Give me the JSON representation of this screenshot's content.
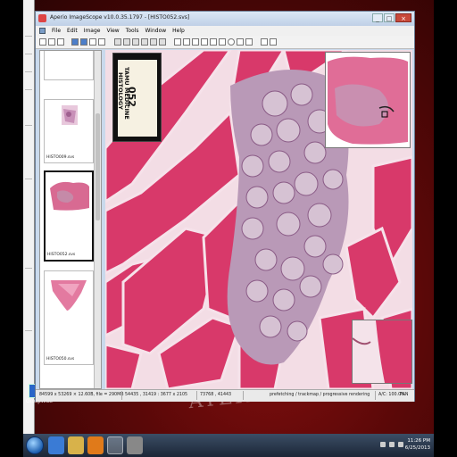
{
  "window": {
    "title": "Aperio ImageScope v10.0.35.1797 - [HISTO052.svs]",
    "buttons": {
      "minimize": "_",
      "maximize": "□",
      "close": "×"
    }
  },
  "menu": [
    "File",
    "Edit",
    "Image",
    "View",
    "Tools",
    "Window",
    "Help"
  ],
  "thumbnails": [
    {
      "label": "",
      "selected": false
    },
    {
      "label": "HISTO009.svs",
      "selected": false
    },
    {
      "label": "HISTO052.svs",
      "selected": true
    },
    {
      "label": "HISTO050.svs",
      "selected": false
    }
  ],
  "slide_label": {
    "number": "052",
    "line1": "TAMU MEDICINE",
    "line2": "HISTOLOGY"
  },
  "statusbar": {
    "dimensions": "84599 x 53269 × 12.60B, file = 290MB",
    "coords": "54435 , 31419 : 3677 x 2105",
    "pixel": "73768 , 41443",
    "rendering": "prefetching / trackmap / progressive rendering",
    "zoom": "A/C: 100.0%",
    "mode": "PAN"
  },
  "desktop": {
    "groupwise_label": "GroupWise",
    "watermark": "ATERIN"
  },
  "clock": {
    "time": "11:26 PM",
    "date": "6/25/2013"
  },
  "colors": {
    "muscle": "#d83a6a",
    "gland": "#c9b0c8",
    "background": "#f3e0e6"
  }
}
